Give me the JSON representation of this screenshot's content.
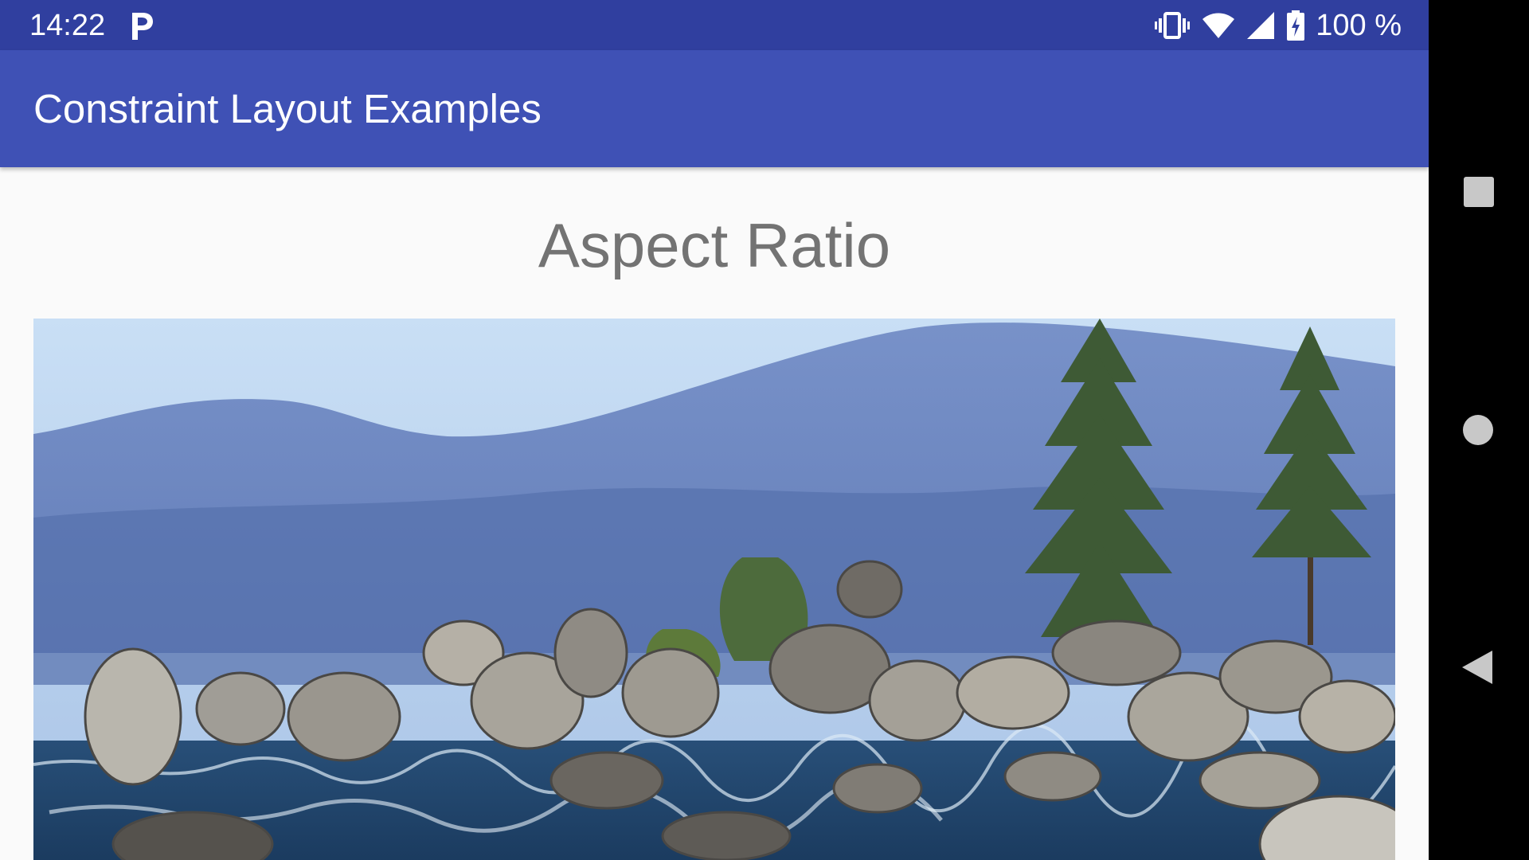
{
  "status_bar": {
    "time": "14:22",
    "battery_text": "100 %",
    "icons": [
      "parking-icon",
      "vibrate-icon",
      "wifi-icon",
      "signal-icon",
      "battery-charging-icon"
    ]
  },
  "toolbar": {
    "title": "Constraint Layout Examples",
    "color": "#3f51b5"
  },
  "status_bar_color": "#303f9f",
  "content": {
    "heading": "Aspect Ratio",
    "image": "lake-rocks-pine-trees-photo"
  },
  "nav_bar": {
    "buttons": [
      "recents-icon",
      "home-icon",
      "back-icon"
    ]
  }
}
